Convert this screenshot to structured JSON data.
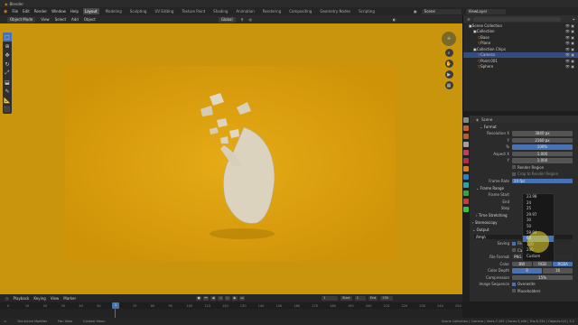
{
  "app": {
    "title": "Blender"
  },
  "menubar": {
    "menus": [
      "File",
      "Edit",
      "Render",
      "Window",
      "Help"
    ],
    "workspaces": [
      "Layout",
      "Modeling",
      "Sculpting",
      "UV Editing",
      "Texture Paint",
      "Shading",
      "Animation",
      "Rendering",
      "Compositing",
      "Geometry Nodes",
      "Scripting"
    ],
    "active_workspace": "Layout",
    "scene": "Scene",
    "view_layer": "ViewLayer"
  },
  "viewport_header": {
    "mode": "Object Mode",
    "menus": [
      "View",
      "Select",
      "Add",
      "Object"
    ],
    "transform": "Global"
  },
  "outliner": {
    "items": [
      {
        "label": "Scene Collection",
        "indent": 0
      },
      {
        "label": "Collection",
        "indent": 1
      },
      {
        "label": "Base",
        "indent": 2
      },
      {
        "label": "Plane",
        "indent": 2
      },
      {
        "label": "Collection Chips",
        "indent": 1
      },
      {
        "label": "Camera",
        "indent": 2,
        "selected": true
      },
      {
        "label": "Point.001",
        "indent": 2
      },
      {
        "label": "Sphere",
        "indent": 2
      }
    ]
  },
  "properties": {
    "breadcrumb": "Scene",
    "format_header": "Format",
    "rows": [
      {
        "label": "Resolution X",
        "value": "3840 px"
      },
      {
        "label": "Y",
        "value": "2160 px"
      },
      {
        "label": "%",
        "value": "100%",
        "blue": true
      },
      {
        "label": "Aspect X",
        "value": "1.000"
      },
      {
        "label": "Y",
        "value": "1.000"
      }
    ],
    "render_region": "Render Region",
    "crop": "Crop to Render Region",
    "frame_rate_label": "Frame Rate",
    "frame_rate_value": "24 fps",
    "frame_range": "Frame Range",
    "frame_start_label": "Frame Start",
    "end_label": "End",
    "step_label": "Step",
    "time_stretching": "Time Stretching",
    "stereoscopy": "Stereoscopy",
    "output": "Output",
    "output_path": "/tmp\\",
    "saving_label": "Saving",
    "file_extensions": "File Extensions",
    "cache_result": "Cache Result",
    "file_format_label": "File Format",
    "file_format_value": "PNG",
    "color_label": "Color",
    "color_options": [
      "BW",
      "RGB",
      "RGBA"
    ],
    "color_depth_label": "Color Depth",
    "color_depth_options": [
      "8",
      "16"
    ],
    "compression_label": "Compression",
    "compression_value": "15%",
    "image_sequence_label": "Image Sequence",
    "overwrite": "Overwrite",
    "placeholders": "Placeholders"
  },
  "fps_dropdown": {
    "options": [
      "23.98",
      "24",
      "25",
      "29.97",
      "30",
      "50",
      "59.94",
      "60",
      "120",
      "240",
      "Custom"
    ],
    "highlighted": "60"
  },
  "timeline": {
    "menus": [
      "Playback",
      "Keying",
      "View",
      "Marker"
    ],
    "current_frame": "1",
    "start_label": "Start",
    "start_value": "1",
    "end_label": "End",
    "end_value": "250",
    "ticks": [
      "0",
      "10",
      "20",
      "30",
      "40",
      "50",
      "60",
      "70",
      "80",
      "90",
      "100",
      "110",
      "120",
      "130",
      "140",
      "150",
      "160",
      "170",
      "180",
      "190",
      "200",
      "210",
      "220",
      "230",
      "240",
      "250"
    ]
  },
  "status": {
    "left": "Set Active Modifier",
    "mid1": "Pan View",
    "mid2": "Context Menu",
    "right": "Scene Collection | Camera | Verts:7,287 | Faces:3,496 | Tris:6,334 | Objects:0/4 | 3.2"
  },
  "colors": {
    "viewport_bg": "#c8950d",
    "camera_bg": "#d79c09",
    "accent": "#4772b3"
  }
}
